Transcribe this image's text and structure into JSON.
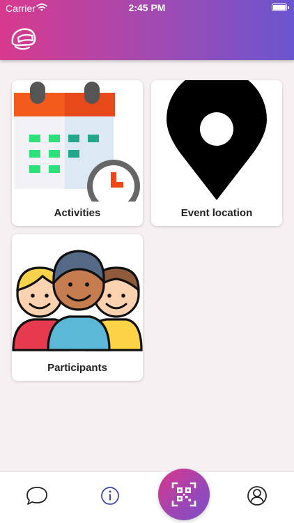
{
  "status_bar": {
    "carrier": "Carrier",
    "time": "2:45 PM"
  },
  "header": {
    "logo_icon": "helmet-logo-icon"
  },
  "colors": {
    "gradient_start": "#d83a8d",
    "gradient_end": "#6a55cf",
    "background": "#f6f0f2"
  },
  "tiles": [
    {
      "label": "Activities",
      "icon": "calendar-clock-icon"
    },
    {
      "label": "Event location",
      "icon": "map-pin-icon"
    },
    {
      "label": "Participants",
      "icon": "people-group-icon"
    }
  ],
  "tabbar": {
    "items": [
      {
        "icon": "chat-bubble-icon"
      },
      {
        "icon": "info-icon"
      },
      {
        "icon": "qr-code-icon"
      },
      {
        "icon": "user-profile-icon"
      }
    ]
  }
}
